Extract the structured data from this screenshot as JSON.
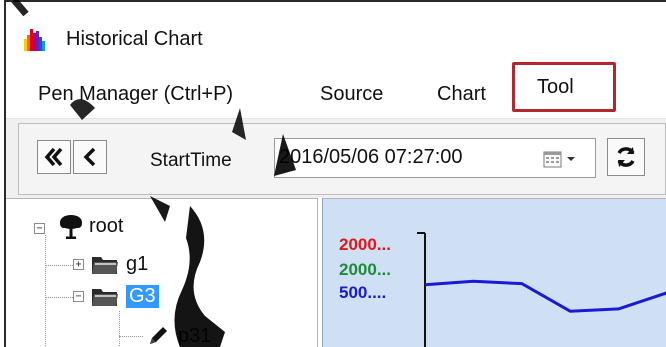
{
  "window": {
    "title": "Historical Chart",
    "icon": "bar-chart-app-icon"
  },
  "menu": {
    "items": [
      {
        "label": "Pen Manager (Ctrl+P)"
      },
      {
        "label": "Source"
      },
      {
        "label": "Chart"
      },
      {
        "label": "Tool",
        "highlighted": true
      }
    ],
    "highlight_color": "#b3282d"
  },
  "toolbar": {
    "start_label": "StartTime",
    "start_value": "2016/05/06 07:27:00",
    "buttons": [
      "rewind-fast-icon",
      "step-back-icon",
      "calendar-icon",
      "refresh-icon"
    ]
  },
  "tree": {
    "root": {
      "label": "root",
      "icon": "tree-icon"
    },
    "nodes": [
      {
        "label": "g1",
        "icon": "folder-icon",
        "expanded": false
      },
      {
        "label": "G3",
        "icon": "folder-icon",
        "expanded": true,
        "selected": true
      },
      {
        "label": "p31",
        "icon": "pen-icon"
      }
    ],
    "selection_color": "#3399ff"
  },
  "chart": {
    "background": "#cfe0f4",
    "axis_labels": [
      {
        "text": "2000...",
        "color": "#e01818"
      },
      {
        "text": "2000...",
        "color": "#1e8a3a"
      },
      {
        "text": "500....",
        "color": "#1a1ad6"
      }
    ],
    "series_color": "#1a1ad6"
  },
  "chart_data": {
    "type": "line",
    "title": "",
    "xlabel": "",
    "ylabel": "",
    "tick_labels": [
      "2000...",
      "2000...",
      "500...."
    ],
    "series": [
      {
        "values": [
          355,
          358,
          356,
          332,
          334,
          348
        ]
      }
    ],
    "ylim": [
      300,
      400
    ],
    "grid": false
  }
}
